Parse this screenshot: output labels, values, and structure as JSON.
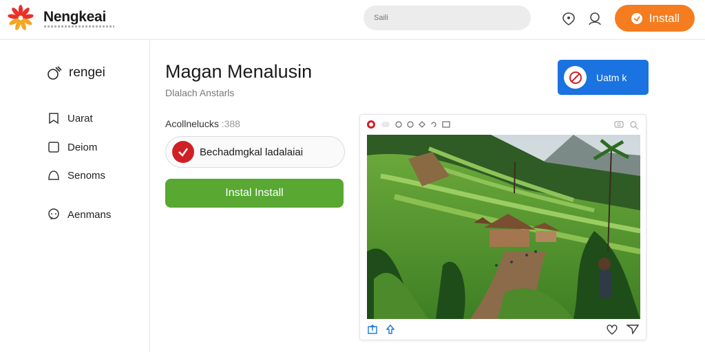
{
  "header": {
    "brand": "Nengkeai",
    "search_placeholder": "Saili",
    "install_label": "Install",
    "accent_color": "#f57c1f"
  },
  "sidebar": {
    "title": "rengei",
    "items": [
      {
        "label": "Uarat",
        "icon": "bookmark-icon"
      },
      {
        "label": "Deiom",
        "icon": "square-icon"
      },
      {
        "label": "Senoms",
        "icon": "bell-icon"
      },
      {
        "label": "Aenmans",
        "icon": "chat-icon"
      }
    ]
  },
  "main": {
    "title": "Magan Menalusin",
    "subtitle": "Dlalach Anstarls",
    "blue_button_label": "Uatm k",
    "section_label": "Acollnelucks",
    "section_count": ":388",
    "app_name": "Bechadmgkal ladalaiai",
    "green_button_label": "Instal Install",
    "green_color": "#58a832",
    "blue_color": "#1a73e0"
  },
  "preview": {
    "image_alt": "Terraced rice fields with thatched hut, banana trees and palm trees"
  }
}
